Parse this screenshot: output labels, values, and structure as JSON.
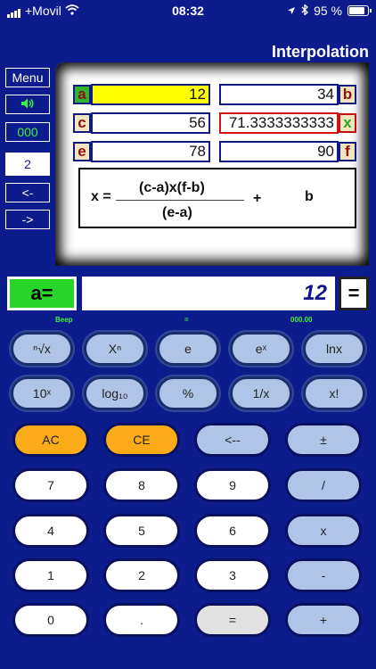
{
  "status": {
    "carrier": "+Movil",
    "time": "08:32",
    "battery": "95 %"
  },
  "title": "Interpolation",
  "side": {
    "menu": "Menu",
    "count": "000",
    "value": "2",
    "prev": "<-",
    "next": "->"
  },
  "table": {
    "a": {
      "tag": "a",
      "value": "12"
    },
    "b": {
      "tag": "b",
      "value": "34"
    },
    "c": {
      "tag": "c",
      "value": "56"
    },
    "x": {
      "tag": "x",
      "value": "71.3333333333"
    },
    "e": {
      "tag": "e",
      "value": "78"
    },
    "f": {
      "tag": "f",
      "value": "90"
    }
  },
  "formula": {
    "lhs": "x =",
    "numerator": "(c-a)x(f-b)",
    "denominator": "(e-a)",
    "plus": "+",
    "b": "b"
  },
  "display": {
    "var": "a=",
    "value": "12",
    "equals": "="
  },
  "sublabels": {
    "beep": "Beep",
    "eq": "=",
    "memory": "000.00"
  },
  "keys": {
    "row1": [
      "ⁿ√x",
      "Xⁿ",
      "e",
      "eˣ",
      "lnx"
    ],
    "row2": [
      "10ˣ",
      "log₁₀",
      "%",
      "1/x",
      "x!"
    ],
    "ac": "AC",
    "ce": "CE",
    "back": "<--",
    "pm": "±",
    "n7": "7",
    "n8": "8",
    "n9": "9",
    "div": "/",
    "n4": "4",
    "n5": "5",
    "n6": "6",
    "mul": "x",
    "n1": "1",
    "n2": "2",
    "n3": "3",
    "sub": "-",
    "n0": "0",
    "dot": ".",
    "eq": "=",
    "add": "+"
  }
}
